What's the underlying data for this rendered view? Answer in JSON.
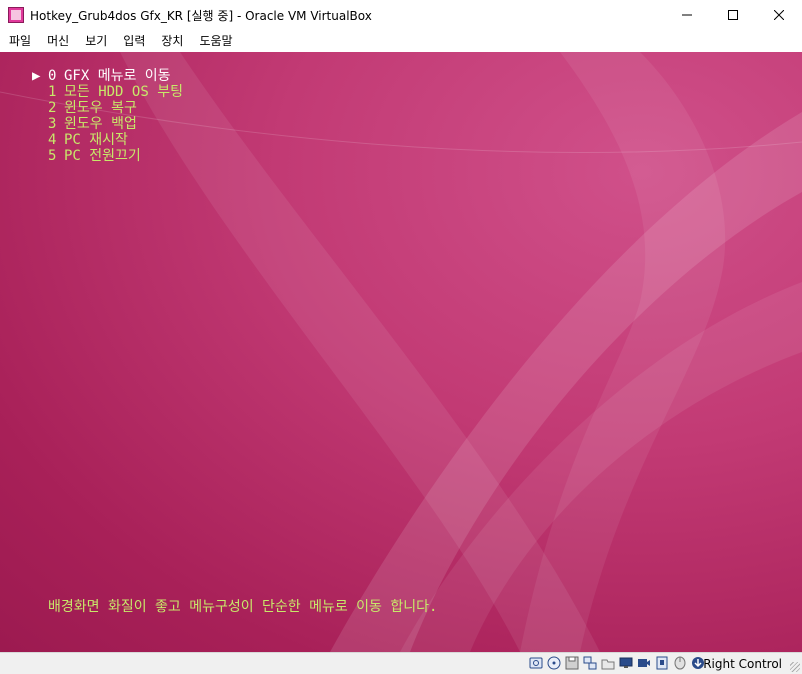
{
  "window": {
    "title": "Hotkey_Grub4dos Gfx_KR [실행 중] - Oracle VM VirtualBox",
    "controls": {
      "minimize": "—",
      "maximize": "☐",
      "close": "✕"
    }
  },
  "menubar": {
    "items": [
      "파일",
      "머신",
      "보기",
      "입력",
      "장치",
      "도움말"
    ]
  },
  "vm": {
    "boot_menu": [
      {
        "pointer": "▶",
        "num": "0",
        "label": "GFX 메뉴로 이동",
        "selected": true
      },
      {
        "pointer": "",
        "num": "1",
        "label": "모든 HDD OS 부팅",
        "selected": false
      },
      {
        "pointer": "",
        "num": "2",
        "label": "윈도우 복구",
        "selected": false
      },
      {
        "pointer": "",
        "num": "3",
        "label": "윈도우 백업",
        "selected": false
      },
      {
        "pointer": "",
        "num": "4",
        "label": "PC 재시작",
        "selected": false
      },
      {
        "pointer": "",
        "num": "5",
        "label": "PC 전원끄기",
        "selected": false
      }
    ],
    "footer": "배경화면 화질이 좋고 메뉴구성이 단순한 메뉴로 이동 합니다.",
    "colors": {
      "selected_text": "#ffffff",
      "menu_text": "#c8e86a",
      "background": "#b02860"
    }
  },
  "statusbar": {
    "icons": [
      "hard-disk-icon",
      "optical-drive-icon",
      "floppy-icon",
      "network-icon",
      "shared-folders-icon",
      "display-icon",
      "video-capture-icon",
      "usb-icon",
      "mouse-integration-icon",
      "keyboard-capture-icon"
    ],
    "host_key": "Right Control"
  }
}
